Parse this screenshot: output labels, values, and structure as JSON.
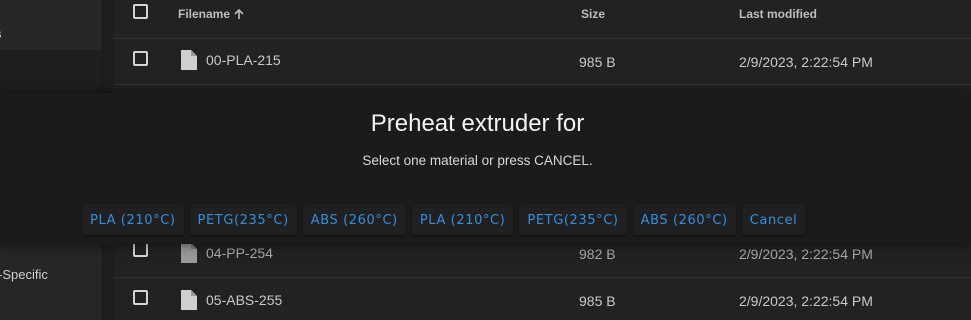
{
  "sidebar": {
    "items": [
      {
        "label": "s"
      },
      {
        "label": "-Specific"
      }
    ]
  },
  "table": {
    "columns": {
      "filename": "Filename",
      "size": "Size",
      "modified": "Last modified"
    },
    "sort_icon": "arrow-up-icon",
    "rows": [
      {
        "name": "00-PLA-215",
        "size": "985 B",
        "modified": "2/9/2023, 2:22:54 PM"
      },
      {
        "name": "04-PP-254",
        "size": "982 B",
        "modified": "2/9/2023, 2:22:54 PM"
      },
      {
        "name": "05-ABS-255",
        "size": "985 B",
        "modified": "2/9/2023, 2:22:54 PM"
      }
    ]
  },
  "dialog": {
    "title": "Preheat extruder for",
    "subtitle": "Select one material or press CANCEL.",
    "buttons": [
      "PLA (210°C)",
      "PETG(235°C)",
      "ABS (260°C)",
      "PLA (210°C)",
      "PETG(235°C)",
      "ABS (260°C)",
      "Cancel"
    ]
  },
  "colors": {
    "accent": "#2f8fe0",
    "background": "#1e1e1e",
    "dialog": "#1b1b1b"
  }
}
